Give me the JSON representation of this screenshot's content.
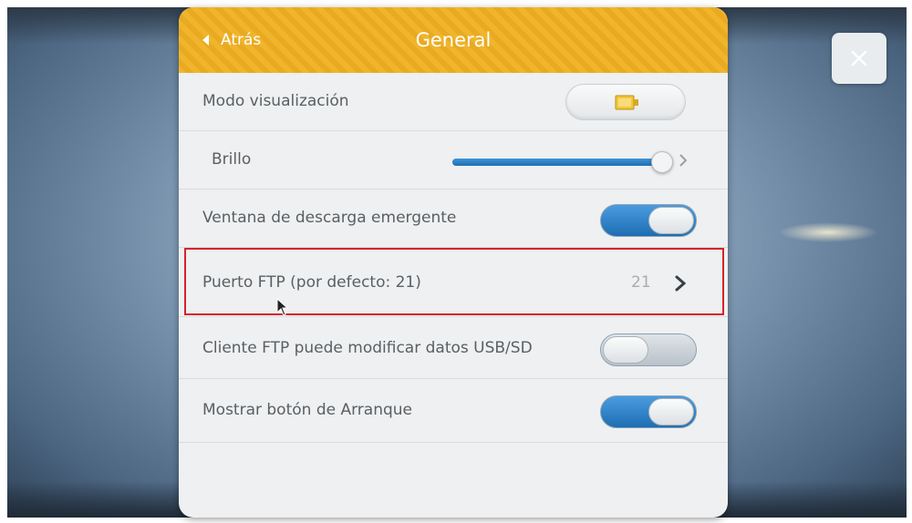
{
  "header": {
    "back_label": "Atrás",
    "title": "General"
  },
  "rows": [
    {
      "label": "Modo visualización",
      "control": "button",
      "icon": "display-mode-icon"
    },
    {
      "label": "Brillo",
      "control": "slider",
      "value_fraction": 0.97
    },
    {
      "label": "Ventana de descarga emergente",
      "control": "toggle",
      "state": "on"
    },
    {
      "label": "Puerto FTP (por defecto: 21)",
      "control": "value",
      "value": "21",
      "highlighted": true
    },
    {
      "label": "Cliente FTP puede modificar datos USB/SD",
      "control": "toggle",
      "state": "off"
    },
    {
      "label": "Mostrar botón de Arranque",
      "control": "toggle",
      "state": "on"
    }
  ],
  "colors": {
    "header": "#f0b52b",
    "toggle_on": "#1e6db3",
    "highlight": "#d8222a"
  }
}
